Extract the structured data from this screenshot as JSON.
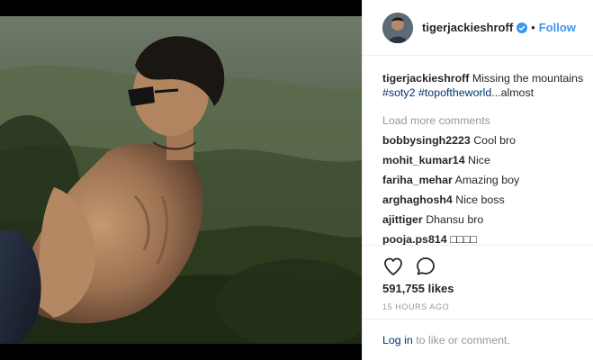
{
  "header": {
    "username": "tigerjackieshroff",
    "separator": "•",
    "follow_label": "Follow"
  },
  "caption": {
    "username": "tigerjackieshroff",
    "text": "Missing the mountains",
    "hashtag_1": "#soty2",
    "hashtag_2": "#topoftheworld",
    "tail": "...almost"
  },
  "load_more_label": "Load more comments",
  "comments": [
    {
      "user": "bobbysingh2223",
      "text": "Cool bro"
    },
    {
      "user": "mohit_kumar14",
      "text": "Nice"
    },
    {
      "user": "fariha_mehar",
      "text": "Amazing boy"
    },
    {
      "user": "arghaghosh4",
      "text": "Nice boss"
    },
    {
      "user": "ajittiger",
      "text": "Dhansu bro"
    },
    {
      "user": "pooja.ps814",
      "text": "□□□□"
    }
  ],
  "likes": "591,755 likes",
  "time": "15 HOURS AGO",
  "login": {
    "link": "Log in",
    "rest": "to like or comment."
  },
  "colors": {
    "accent": "#3897f0",
    "link": "#003569",
    "muted": "#999999",
    "verified": "#3897f0"
  },
  "icons": {
    "like": "heart-icon",
    "comment": "comment-bubble-icon",
    "verified": "verified-badge-icon"
  }
}
